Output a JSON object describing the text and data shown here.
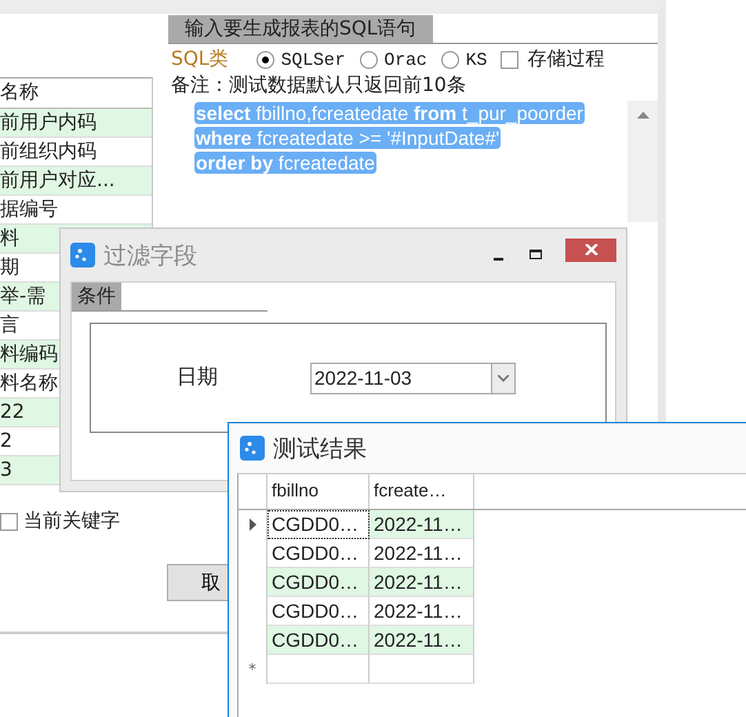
{
  "background_window": {
    "field_list": {
      "header": "名称",
      "rows": [
        "前用户内码",
        "前组织内码",
        "前用户对应...",
        "据编号",
        "料",
        "期",
        "举-需",
        "言",
        "料编码",
        "料名称",
        "22",
        "2",
        "3"
      ]
    },
    "keyword_checkbox": {
      "label": "当前关键字",
      "checked": false
    },
    "cancel_button": "取"
  },
  "sql_panel": {
    "tab": "输入要生成报表的SQL语句",
    "type_label": "SQL类",
    "db_types": [
      {
        "label": "SQLSer",
        "selected": true
      },
      {
        "label": "Orac",
        "selected": false
      },
      {
        "label": "KS",
        "selected": false
      }
    ],
    "stored_procedure": {
      "label": "存储过程",
      "checked": false
    },
    "note": "备注：测试数据默认只返回前10条",
    "sql_lines": [
      "**select** fbillno,fcreatedate **from** t_pur_poorder",
      "**where** fcreatedate >= '#InputDate#'",
      "**order by** fcreatedate"
    ]
  },
  "filter_window": {
    "title": "过滤字段",
    "tab": "条件",
    "field_label": "日期",
    "date_value": "2022-11-03"
  },
  "result_window": {
    "title": "测试结果",
    "columns": [
      "fbillno",
      "fcreate…"
    ],
    "rows": [
      {
        "cells": [
          "CGDD0…",
          "2022-11…"
        ],
        "current": true
      },
      {
        "cells": [
          "CGDD0…",
          "2022-11…"
        ],
        "current": false
      },
      {
        "cells": [
          "CGDD0…",
          "2022-11…"
        ],
        "current": false
      },
      {
        "cells": [
          "CGDD0…",
          "2022-11…"
        ],
        "current": false
      },
      {
        "cells": [
          "CGDD0…",
          "2022-11…"
        ],
        "current": false
      }
    ],
    "new_row_marker": "*"
  }
}
